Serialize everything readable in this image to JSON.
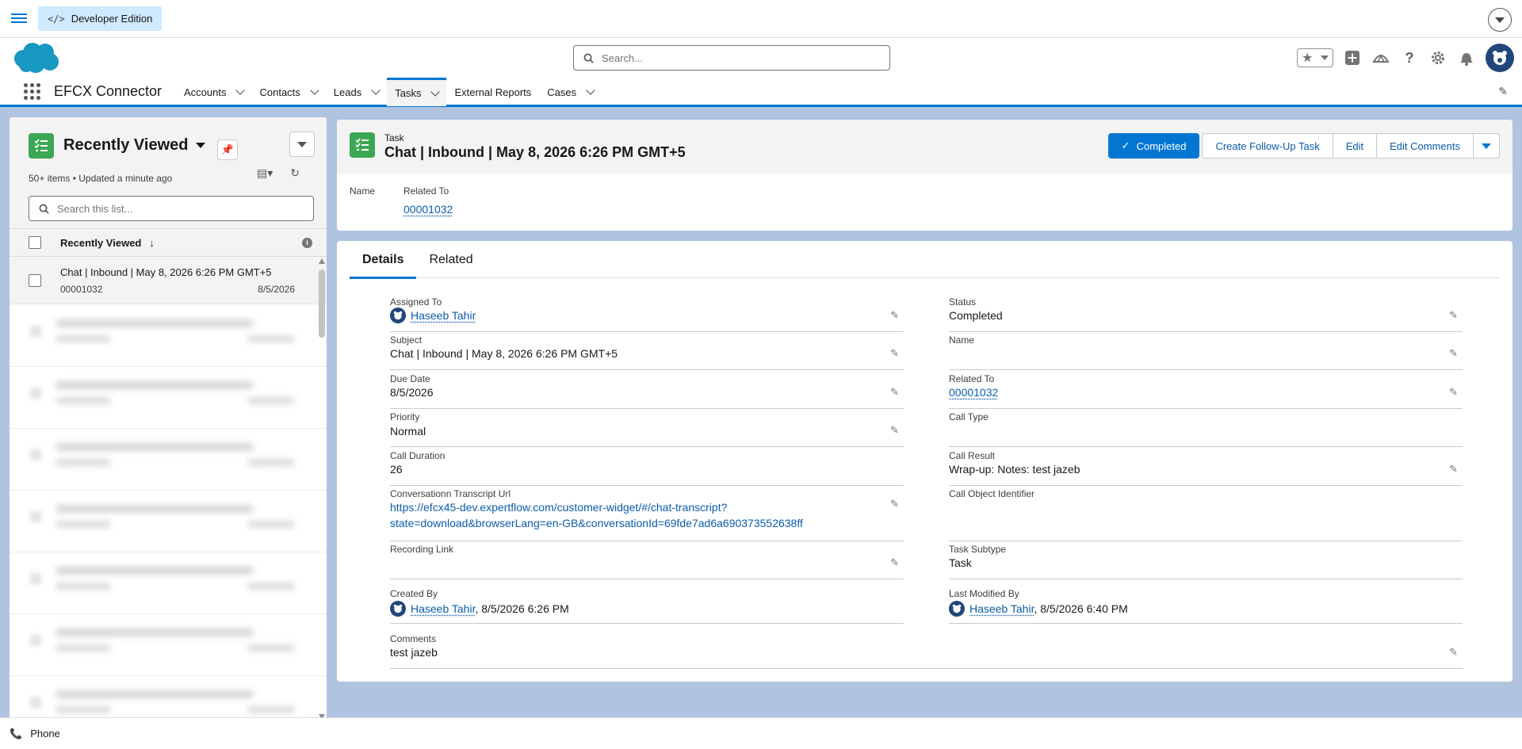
{
  "topbar": {
    "edition_label": "Developer Edition",
    "edition_icon": "code-icon"
  },
  "header": {
    "search_placeholder": "Search...",
    "icons": [
      "favorites-star-icon",
      "add-icon",
      "trailhead-icon",
      "help-icon",
      "setup-gear-icon",
      "bell-icon",
      "user-avatar"
    ]
  },
  "nav": {
    "app_name": "EFCX Connector",
    "tabs": [
      {
        "label": "Accounts",
        "active": false
      },
      {
        "label": "Contacts",
        "active": false
      },
      {
        "label": "Leads",
        "active": false
      },
      {
        "label": "Tasks",
        "active": true
      },
      {
        "label": "External Reports",
        "active": false
      },
      {
        "label": "Cases",
        "active": false
      }
    ]
  },
  "list": {
    "title": "Recently Viewed",
    "meta": "50+ items • Updated a minute ago",
    "search_placeholder": "Search this list...",
    "column_header": "Recently Viewed",
    "rows": [
      {
        "title": "Chat | Inbound | May 8, 2026 6:26 PM GMT+5",
        "sub": "00001032",
        "date": "8/5/2026"
      }
    ]
  },
  "record": {
    "object_label": "Task",
    "name": "Chat | Inbound | May 8, 2026 6:26 PM GMT+5",
    "actions": {
      "completed": "Completed",
      "follow_up": "Create Follow-Up Task",
      "edit": "Edit",
      "edit_comments": "Edit Comments"
    },
    "header_fields": [
      {
        "label": "Name",
        "value": ""
      },
      {
        "label": "Related To",
        "value": "00001032"
      }
    ]
  },
  "tabs": {
    "details": "Details",
    "related": "Related"
  },
  "details": {
    "assigned_to": {
      "label": "Assigned To",
      "value": "Haseeb Tahir"
    },
    "status": {
      "label": "Status",
      "value": "Completed"
    },
    "subject": {
      "label": "Subject",
      "value": "Chat | Inbound | May 8, 2026 6:26 PM GMT+5"
    },
    "name": {
      "label": "Name",
      "value": ""
    },
    "due_date": {
      "label": "Due Date",
      "value": "8/5/2026"
    },
    "related_to": {
      "label": "Related To",
      "value": "00001032"
    },
    "priority": {
      "label": "Priority",
      "value": "Normal"
    },
    "call_type": {
      "label": "Call Type",
      "value": ""
    },
    "call_duration": {
      "label": "Call Duration",
      "value": "26"
    },
    "call_result": {
      "label": "Call Result",
      "value": "Wrap-up: Notes: test jazeb"
    },
    "transcript_url": {
      "label": "Conversationn Transcript Url",
      "line1": "https://efcx45-dev.expertflow.com/customer-widget/#/chat-transcript?",
      "line2": "state=download&browserLang=en-GB&conversationId=69fde7ad6a690373552638ff"
    },
    "call_object_identifier": {
      "label": "Call Object Identifier",
      "value": ""
    },
    "recording_link": {
      "label": "Recording Link",
      "value": ""
    },
    "task_subtype": {
      "label": "Task Subtype",
      "value": "Task"
    },
    "created_by": {
      "label": "Created By",
      "user": "Haseeb Tahir",
      "date": ", 8/5/2026 6:26 PM"
    },
    "last_modified_by": {
      "label": "Last Modified By",
      "user": "Haseeb Tahir",
      "date": ", 8/5/2026 6:40 PM"
    },
    "comments": {
      "label": "Comments",
      "value": "test jazeb"
    }
  },
  "utility": {
    "phone_label": "Phone"
  },
  "colors": {
    "brand_blue": "#0176d3",
    "task_green": "#3ba755",
    "link": "#0b5cab",
    "background": "#b0c4df"
  }
}
